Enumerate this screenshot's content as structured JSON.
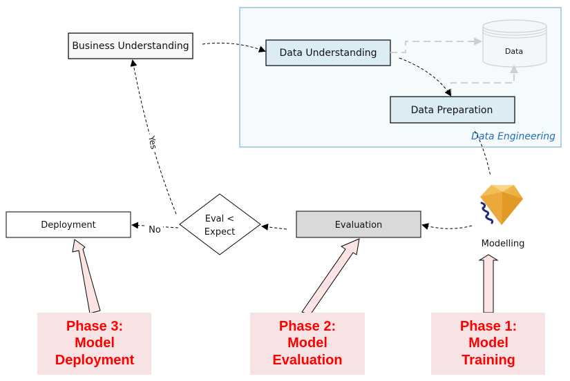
{
  "diagram": {
    "group": {
      "label": "Data Engineering",
      "border_color": "#7fb3d5",
      "fill": "#f5fafc",
      "label_color": "#1f6fbf"
    },
    "nodes": {
      "business_understanding": {
        "label": "Business Understanding",
        "fill": "#f8f8f8"
      },
      "data_understanding": {
        "label": "Data Understanding",
        "fill": "#dbecf4"
      },
      "data_preparation": {
        "label": "Data Preparation",
        "fill": "#dbecf4"
      },
      "data_store": {
        "label": "Data"
      },
      "modelling": {
        "label": "Modelling",
        "icon": "model-gem-icon"
      },
      "evaluation": {
        "label": "Evaluation",
        "fill": "#d9d9d9"
      },
      "decision": {
        "line1": "Eval <",
        "line2": "Expect"
      },
      "deployment": {
        "label": "Deployment",
        "fill": "#ffffff"
      }
    },
    "edge_labels": {
      "yes": "Yes",
      "no": "No"
    },
    "phases": [
      {
        "line1": "Phase 3:",
        "line2": "Model",
        "line3": "Deployment"
      },
      {
        "line1": "Phase 2:",
        "line2": "Model",
        "line3": "Evaluation"
      },
      {
        "line1": "Phase 1:",
        "line2": "Model",
        "line3": "Training"
      }
    ],
    "phase_colors": {
      "text": "#ff0000",
      "box": "#f7e3e3",
      "arrow_fill": "#fde4e4"
    }
  }
}
